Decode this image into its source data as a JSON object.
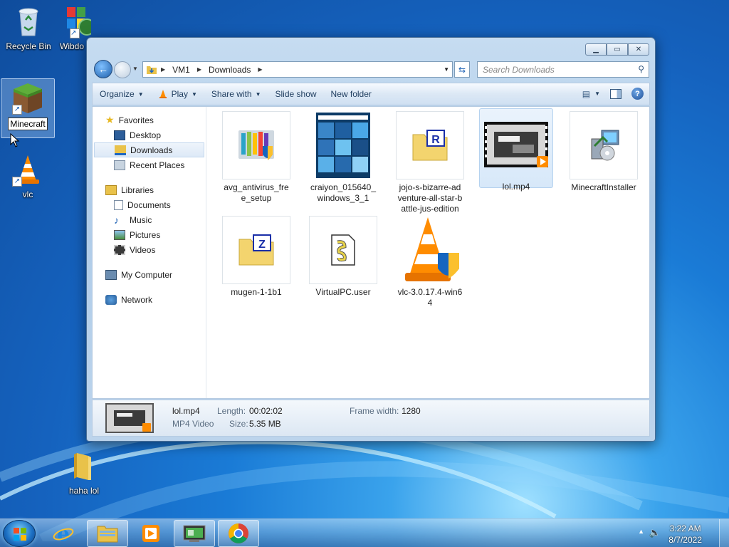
{
  "desktop": {
    "icons": [
      {
        "label": "Recycle Bin"
      },
      {
        "label": "Wibdo"
      },
      {
        "label": "Minecraft"
      },
      {
        "label": "vlc"
      },
      {
        "label": "haha lol"
      }
    ]
  },
  "window": {
    "address": {
      "segments": [
        "VM1",
        "Downloads"
      ]
    },
    "search_placeholder": "Search Downloads",
    "toolbar": {
      "organize": "Organize",
      "play": "Play",
      "share": "Share with",
      "slideshow": "Slide show",
      "newfolder": "New folder"
    },
    "nav": [
      {
        "label": "Favorites",
        "icon": "star-icon"
      },
      {
        "label": "Desktop",
        "icon": "desktop-icon"
      },
      {
        "label": "Downloads",
        "icon": "downloads-folder-icon"
      },
      {
        "label": "Recent Places",
        "icon": "recent-places-icon"
      },
      {
        "label": "Libraries",
        "icon": "libraries-icon"
      },
      {
        "label": "Documents",
        "icon": "documents-icon"
      },
      {
        "label": "Music",
        "icon": "music-icon"
      },
      {
        "label": "Pictures",
        "icon": "pictures-icon"
      },
      {
        "label": "Videos",
        "icon": "videos-icon"
      },
      {
        "label": "My Computer",
        "icon": "computer-icon"
      },
      {
        "label": "Network",
        "icon": "network-icon"
      }
    ],
    "files": [
      {
        "name": "avg_antivirus_fre\ne_setup",
        "icon": "avg-installer-icon"
      },
      {
        "name": "craiyon_015640_\nwindows_3_1",
        "icon": "image-thumbnail"
      },
      {
        "name": "jojo-s-bizarre-ad\nventure-all-star-b\nattle-jus-edition",
        "icon": "rar-archive-icon"
      },
      {
        "name": "lol.mp4",
        "icon": "video-thumbnail"
      },
      {
        "name": "MinecraftInstaller",
        "icon": "msi-installer-icon"
      },
      {
        "name": "mugen-1-1b1",
        "icon": "zip-archive-icon"
      },
      {
        "name": "VirtualPC.user",
        "icon": "script-file-icon"
      },
      {
        "name": "vlc-3.0.17.4-win6\n4",
        "icon": "vlc-installer-icon"
      }
    ],
    "details": {
      "name": "lol.mp4",
      "type": "MP4 Video",
      "length_label": "Length:",
      "length": "00:02:02",
      "size_label": "Size:",
      "size": "5.35 MB",
      "framewidth_label": "Frame width:",
      "framewidth": "1280"
    }
  },
  "taskbar": {
    "time": "3:22 AM",
    "date": "8/7/2022"
  }
}
